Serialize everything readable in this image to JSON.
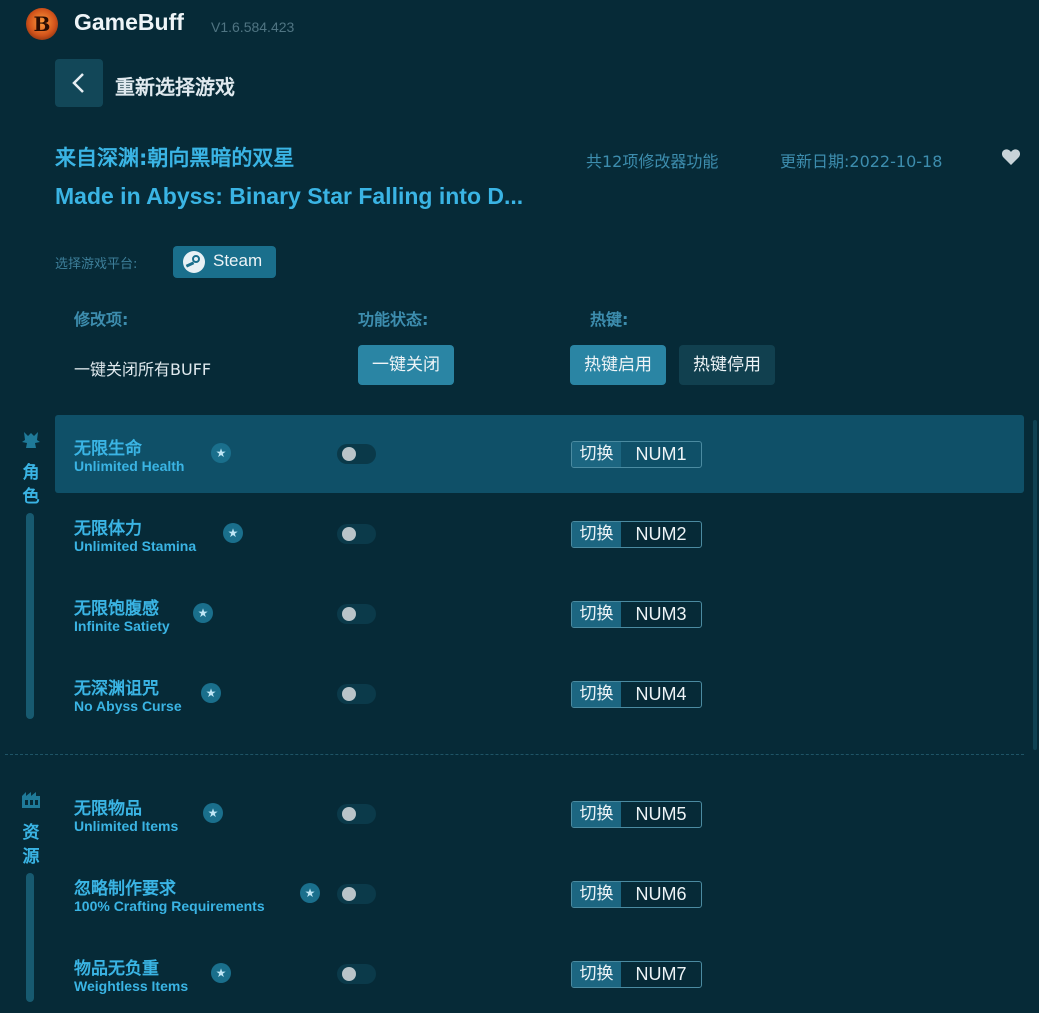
{
  "app": {
    "logo_letter": "B",
    "name": "GameBuff",
    "version": "V1.6.584.423"
  },
  "nav": {
    "reselect_label": "重新选择游戏"
  },
  "game": {
    "title_cn": "来自深渊:朝向黑暗的双星",
    "title_en": "Made in Abyss: Binary Star Falling into D...",
    "feature_count": "共12项修改器功能",
    "update_date": "更新日期:2022-10-18"
  },
  "platform": {
    "label": "选择游戏平台:",
    "selected": "Steam"
  },
  "columns": {
    "mods": "修改项:",
    "status": "功能状态:",
    "hotkey": "热键:"
  },
  "global": {
    "label": "一键关闭所有BUFF",
    "off_button": "一键关闭",
    "hotkey_on": "热键启用",
    "hotkey_off": "热键停用"
  },
  "categories": [
    {
      "name": "角色",
      "chars": [
        "角",
        "色"
      ],
      "icon": "character-icon"
    },
    {
      "name": "资源",
      "chars": [
        "资",
        "源"
      ],
      "icon": "resource-icon"
    }
  ],
  "cheats": [
    {
      "cn": "无限生命",
      "en": "Unlimited Health",
      "on": false,
      "switch": "切换",
      "key": "NUM1"
    },
    {
      "cn": "无限体力",
      "en": "Unlimited Stamina",
      "on": false,
      "switch": "切换",
      "key": "NUM2"
    },
    {
      "cn": "无限饱腹感",
      "en": "Infinite Satiety",
      "on": false,
      "switch": "切换",
      "key": "NUM3"
    },
    {
      "cn": "无深渊诅咒",
      "en": "No Abyss Curse",
      "on": false,
      "switch": "切换",
      "key": "NUM4"
    },
    {
      "cn": "无限物品",
      "en": "Unlimited Items",
      "on": false,
      "switch": "切换",
      "key": "NUM5"
    },
    {
      "cn": "忽略制作要求",
      "en": "100% Crafting Requirements",
      "on": false,
      "switch": "切换",
      "key": "NUM6"
    },
    {
      "cn": "物品无负重",
      "en": "Weightless Items",
      "on": false,
      "switch": "切换",
      "key": "NUM7"
    }
  ],
  "colors": {
    "background": "#062a37",
    "accent": "#3ab4e4",
    "button": "#2a85a4",
    "active_row": "#0f5068"
  }
}
